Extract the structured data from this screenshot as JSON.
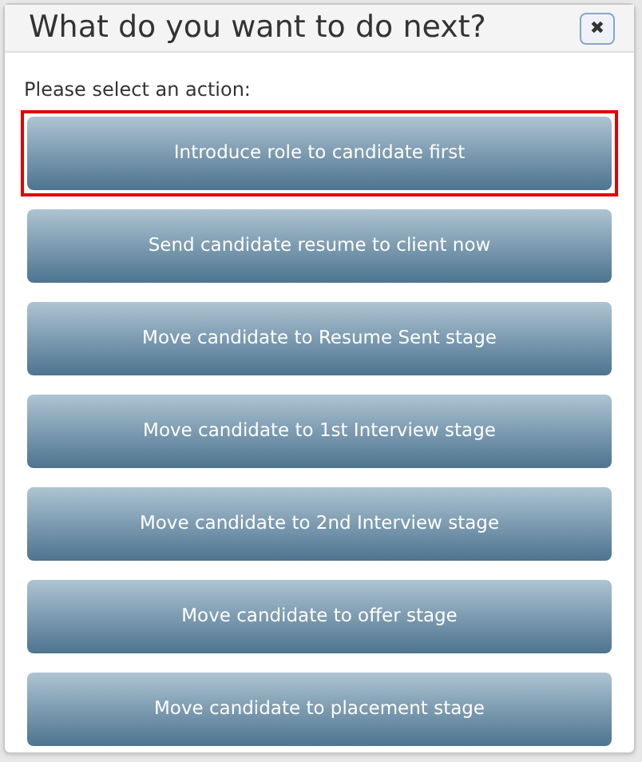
{
  "dialog": {
    "title": "What do you want to do next?",
    "close_label": "✖",
    "prompt": "Please select an action:",
    "actions": [
      {
        "label": "Introduce role to candidate first",
        "highlighted": true
      },
      {
        "label": "Send candidate resume to client now",
        "highlighted": false
      },
      {
        "label": "Move candidate to Resume Sent stage",
        "highlighted": false
      },
      {
        "label": "Move candidate to 1st Interview stage",
        "highlighted": false
      },
      {
        "label": "Move candidate to 2nd Interview stage",
        "highlighted": false
      },
      {
        "label": "Move candidate to offer stage",
        "highlighted": false
      },
      {
        "label": "Move candidate to placement stage",
        "highlighted": false
      }
    ]
  }
}
